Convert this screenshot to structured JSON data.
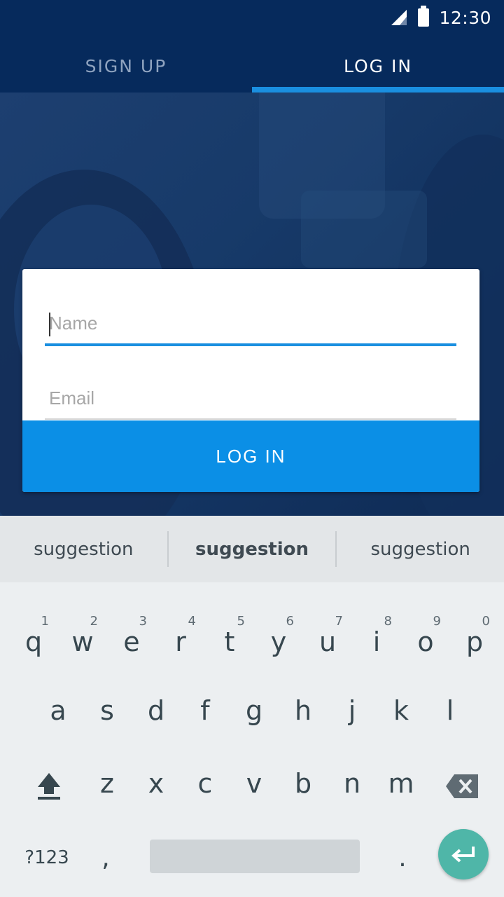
{
  "status": {
    "time": "12:30",
    "signal_icon": "cell-signal-icon",
    "battery_icon": "battery-icon"
  },
  "tabs": [
    {
      "label": "SIGN UP",
      "active": false
    },
    {
      "label": "LOG IN",
      "active": true
    }
  ],
  "form": {
    "name_placeholder": "Name",
    "email_placeholder": "Email",
    "submit_label": "LOG IN",
    "accent": "#1a8fe0"
  },
  "keyboard": {
    "suggestions": [
      "suggestion",
      "suggestion",
      "suggestion"
    ],
    "row1": [
      {
        "k": "q",
        "n": "1"
      },
      {
        "k": "w",
        "n": "2"
      },
      {
        "k": "e",
        "n": "3"
      },
      {
        "k": "r",
        "n": "4"
      },
      {
        "k": "t",
        "n": "5"
      },
      {
        "k": "y",
        "n": "6"
      },
      {
        "k": "u",
        "n": "7"
      },
      {
        "k": "i",
        "n": "8"
      },
      {
        "k": "o",
        "n": "9"
      },
      {
        "k": "p",
        "n": "0"
      }
    ],
    "row2": [
      "a",
      "s",
      "d",
      "f",
      "g",
      "h",
      "j",
      "k",
      "l"
    ],
    "row3": [
      "z",
      "x",
      "c",
      "v",
      "b",
      "n",
      "m"
    ],
    "symbols_label": "?123",
    "comma": ",",
    "period": ".",
    "enter_color": "#4fb6a8"
  }
}
